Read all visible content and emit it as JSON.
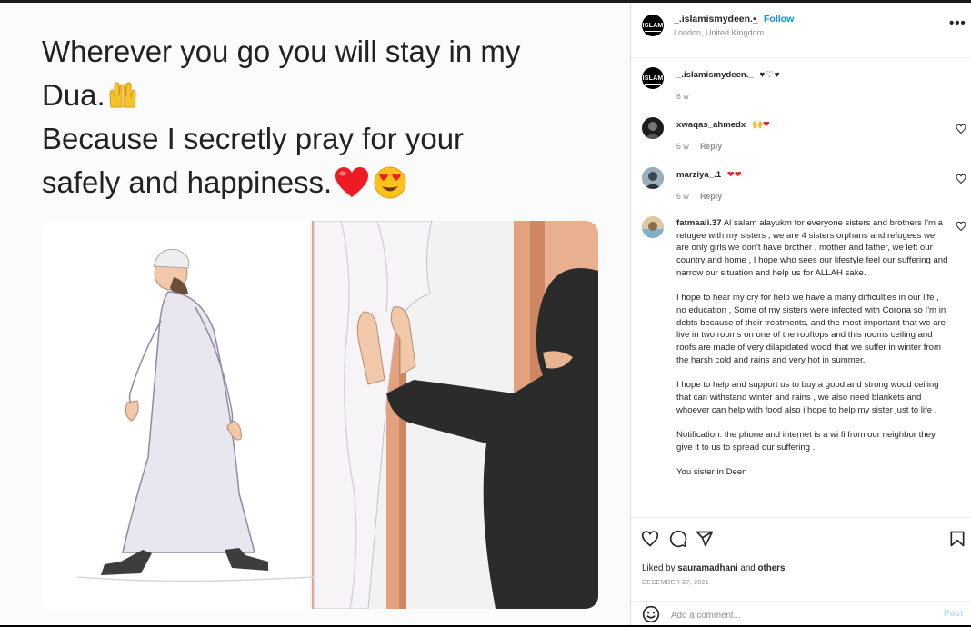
{
  "image": {
    "lines": [
      "Wherever you go you will stay in my",
      "Dua.",
      "Because I secretly pray for your",
      "safely and happiness."
    ]
  },
  "header": {
    "username": "_.islamismydeen._",
    "separator": "•",
    "follow_label": "Follow",
    "location": "London, United Kingdom",
    "more_label": "•••",
    "avatar_text": "ISLAM"
  },
  "caption": {
    "username": "_.islamismydeen._",
    "emojis": "♥♡♥",
    "time": "6 w",
    "avatar_text": "ISLAM"
  },
  "comments": [
    {
      "username": "xwaqas_ahmedx",
      "emojis": "🙌❤",
      "time": "6 w",
      "reply": "Reply"
    },
    {
      "username": "marziya_.1",
      "emojis": "❤❤",
      "time": "6 w",
      "reply": "Reply"
    },
    {
      "username": "fatmaali.37",
      "paragraphs": [
        "Al salam alayukm for everyone sisters and brothers I'm a refugee with my sisters , we are 4 sisters orphans and refugees we are only girls we don't have brother , mother and father, we left our country and home , I hope who sees our lifestyle feel our suffering and narrow our situation and help us for ALLAH sake.",
        "I hope to hear my cry for help we have a many difficulties in our life , no education , Some of my sisters were infected with Corona so I'm in debts because of their treatments, and the most important that we are live in two rooms on one of the rooftops and this rooms ceiling and roofs are made of very dilapidated wood that we suffer in winter from the harsh cold and rains and very hot in summer.",
        "I hope to help and support us to buy a good and strong wood ceiling that can withstand winter and rains , we also need blankets and whoever can help with food also i hope to help my sister just to life .",
        "Notification: the phone and internet is a wi fi from our neighbor they give it to us to spread our suffering .",
        "You sister in Deen"
      ]
    }
  ],
  "actions": {
    "liked_by_prefix": "Liked by",
    "liked_by_user": "sauramadhani",
    "liked_by_and": "and",
    "liked_by_others": "others",
    "date": "DECEMBER 27, 2021",
    "comment_placeholder": "Add a comment...",
    "post_label": "Post"
  },
  "colors": {
    "link_blue": "#0095f6",
    "post_disabled": "#b2dffc",
    "heart_red": "#ed1c24"
  }
}
